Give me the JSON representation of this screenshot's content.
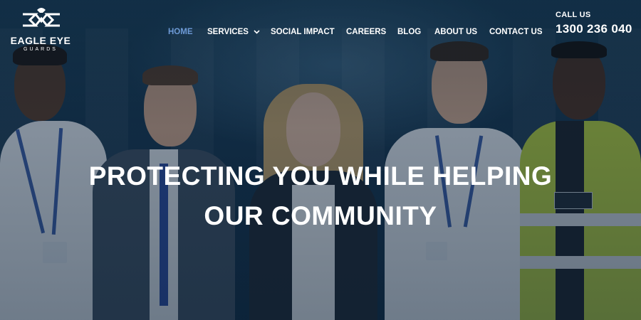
{
  "brand": {
    "name": "EAGLE EYE",
    "tagline": "GUARDS"
  },
  "nav": {
    "items": [
      {
        "label": "HOME",
        "active": true
      },
      {
        "label": "SERVICES",
        "has_dropdown": true
      },
      {
        "label": "SOCIAL IMPACT"
      },
      {
        "label": "CAREERS"
      },
      {
        "label": "BLOG"
      },
      {
        "label": "ABOUT US"
      },
      {
        "label": "CONTACT US"
      }
    ]
  },
  "contact": {
    "label": "CALL US",
    "phone": "1300 236 040"
  },
  "hero": {
    "headline_line1": "PROTECTING YOU WHILE HELPING",
    "headline_line2": "OUR COMMUNITY"
  },
  "colors": {
    "active_nav": "#6d9ad6",
    "overlay": "#0a1e34",
    "text": "#ffffff"
  }
}
